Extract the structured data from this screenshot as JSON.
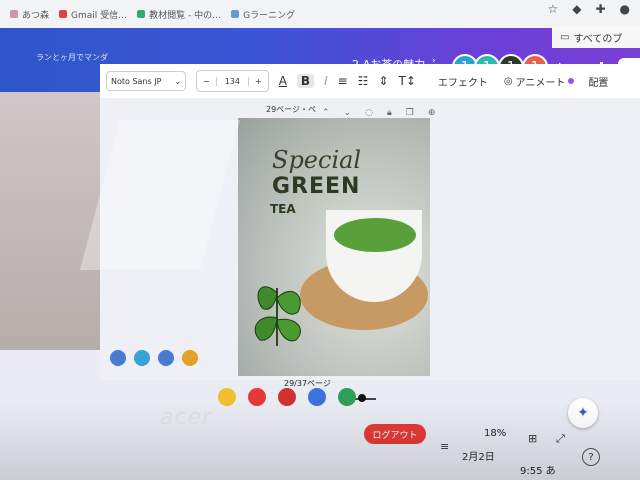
{
  "browser": {
    "bookmarks": [
      "あつ森",
      "Gmail 受信…",
      "教材閲覧 - 中の…",
      "Gラーニング"
    ],
    "all_bookmarks": "すべてのブ"
  },
  "header": {
    "left_title": "ランとヶ月でマンダ",
    "project_title": "2-Aお茶の魅力",
    "collaborators": [
      {
        "label": "1",
        "color": "#2a9fd8"
      },
      {
        "label": "1",
        "color": "#31b7b0"
      },
      {
        "label": "1",
        "color": "#2f3b2a"
      },
      {
        "label": "1",
        "color": "#e5614f"
      }
    ]
  },
  "toolbar": {
    "font": "Noto Sans JP",
    "minus": "−",
    "font_size": "134",
    "plus": "+",
    "effect": "エフェクト",
    "animate": "アニメート",
    "arrange": "配置"
  },
  "canvas": {
    "page_label": "29ページ・ペ",
    "design_text_1": "Special",
    "design_text_2": "GREEN",
    "design_text_3": "TEA"
  },
  "footer": {
    "page_counter": "29/37ページ",
    "zoom": "18%",
    "logout": "ログアウト",
    "date": "2月2日",
    "time": "9:55",
    "ime": "あ",
    "brand": "acer"
  },
  "colors": {
    "header_start": "#2f56c9",
    "header_end": "#7b3fd4",
    "logout": "#e53935"
  }
}
